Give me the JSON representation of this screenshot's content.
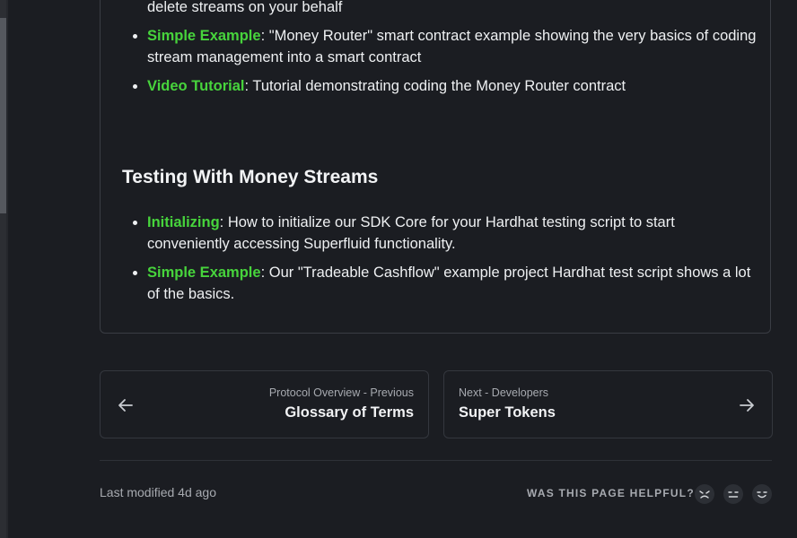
{
  "content": {
    "top_items": [
      {
        "text_tail": "delete streams on your behalf"
      },
      {
        "link": "Simple Example",
        "text": ": \"Money Router\" smart contract example showing the very basics of coding stream management into a smart contract"
      },
      {
        "link": "Video Tutorial",
        "text": ": Tutorial demonstrating coding the Money Router contract"
      }
    ],
    "section_heading": "Testing With Money Streams",
    "testing_items": [
      {
        "link": "Initializing",
        "text": ": How to initialize our SDK Core for your Hardhat testing script to start conveniently accessing Superfluid functionality."
      },
      {
        "link": "Simple Example",
        "text": ": Our \"Tradeable Cashflow\" example project Hardhat test script shows a lot of the basics."
      }
    ]
  },
  "pagination": {
    "previous": {
      "subtitle": "Protocol Overview - Previous",
      "title": "Glossary of Terms"
    },
    "next": {
      "subtitle": "Next - Developers",
      "title": "Super Tokens"
    }
  },
  "footer": {
    "last_modified": "Last modified 4d ago",
    "helpful_prompt": "WAS THIS PAGE HELPFUL?",
    "feedback_icons": [
      "sad-face-icon",
      "neutral-face-icon",
      "happy-face-icon"
    ]
  },
  "colors": {
    "link": "#47d43c",
    "background": "#1b1d22",
    "border": "#3a3d44"
  }
}
